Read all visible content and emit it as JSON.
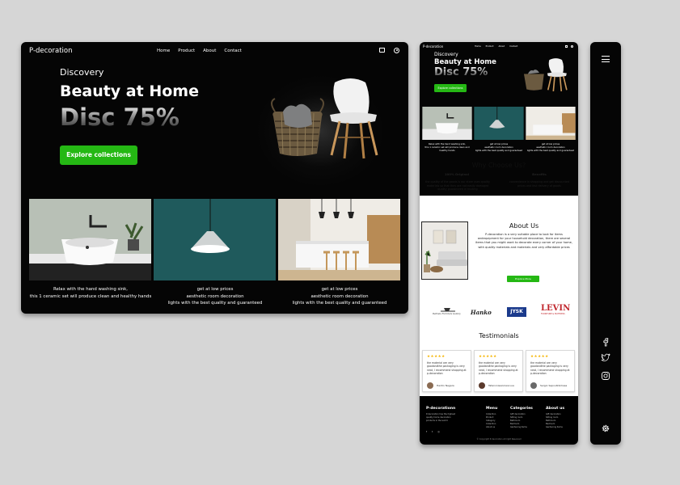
{
  "desktop": {
    "logo": "P-decoration",
    "nav": [
      "Home",
      "Product",
      "About",
      "Contact"
    ],
    "hero": {
      "subtitle": "Discovery",
      "title": "Beauty at Home",
      "discount": "Disc 75%",
      "cta": "Explore collections"
    },
    "cards": [
      {
        "line1": "Relax with the hand washing sink,",
        "line2": "this 1 ceramic set will produce clean and healthy hands",
        "line3": ""
      },
      {
        "line1": "get at low prices",
        "line2": "aesthetic room decoration",
        "line3": "lights with the best quality and guaranteed"
      },
      {
        "line1": "get at low prices",
        "line2": "aesthetic room decoration",
        "line3": "lights with the best quality and guaranteed"
      }
    ]
  },
  "mobile": {
    "logo": "P-decoration",
    "nav": [
      "Home",
      "Product",
      "About",
      "Contact"
    ],
    "hero": {
      "subtitle": "Discovery",
      "title": "Beauty at Home",
      "discount": "Disc 75%",
      "cta": "Explore collections"
    },
    "cards": [
      {
        "line1": "Relax with the hand washing sink,",
        "line2": "this 1 ceramic set will produce clean and healthy hands"
      },
      {
        "line1": "get at low prices",
        "line2": "aesthetic room decoration",
        "line3": "lights with the best quality and guaranteed"
      },
      {
        "line1": "get at low prices",
        "line2": "aesthetic room decoration",
        "line3": "lights with the best quality and guaranteed"
      }
    ],
    "why": {
      "title": "Why Choose Us?",
      "col1_title": "100% Original",
      "col1_text": "the quality of the goods is our store uses quality materials so that they are not easily damaged quality guaranteed is trustmg",
      "col2_title": "Benefits",
      "col2_text": "convenience in shopping and get discounted prices and fast delivery of goods"
    },
    "about": {
      "title": "About Us",
      "text": "P-decoration is a very suitable place to look for items andequipment for your household decoration, there are several items that you might want to decorate every corner of your home, with quality materials and materials and very affordable prices",
      "button": "Explore More"
    },
    "brands": [
      "Ballinda Furniture Gallery",
      "Hanko",
      "JYSK",
      "LEVIN",
      "FURNITURE & MATTRESS"
    ],
    "testimonials": {
      "title": "Testimonials",
      "stars": "★★★★★",
      "items": [
        {
          "text": "the material are very goodandthe packaging is very neat, I recommend shopping at p-decoration",
          "name": "Hardin Negara"
        },
        {
          "text": "the material are very goodandthe packaging is very neat, I recommend shopping at p-decoration",
          "name": "Tatanoniswoniwa Lua"
        },
        {
          "text": "the material are very goodandthe packaging is very neat, I recommend shopping at p-decoration",
          "name": "Sergio Sepoutkbcliasa"
        }
      ]
    },
    "footer": {
      "brand": "P-decorationn",
      "brand_text": "P-decoration has the highest quality home decoration products in the world",
      "menu_title": "Menu",
      "menu": [
        "Collection",
        "Product",
        "Category",
        "Collection",
        "About us"
      ],
      "cat_title": "Categories",
      "cat": [
        "Gift decoration",
        "Sitting room",
        "Bathroom",
        "Bedroom",
        "Gardening items"
      ],
      "about_title": "About us",
      "about": [
        "Gift decoration",
        "Sitting room",
        "Bathroom",
        "Bedroom",
        "Gardening items"
      ],
      "copyright": "© Copyright P-decoration All right Reserved"
    }
  }
}
